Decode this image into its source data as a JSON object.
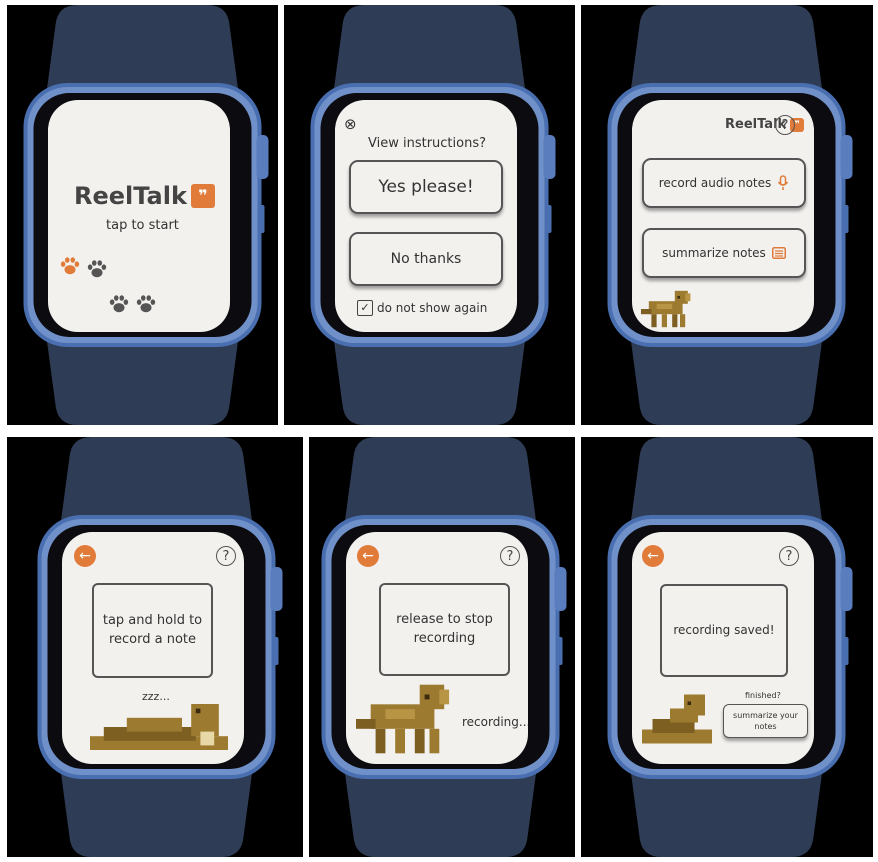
{
  "colors": {
    "accent": "#e07b39",
    "screen_bg": "#f3f1ee",
    "watch_frame": "#4a6fb0",
    "band": "#2e3d55",
    "text": "#333333",
    "cat": "#9c7a2f"
  },
  "icons": [
    "paw-icon",
    "close-circle-icon",
    "checkbox-icon",
    "microphone-icon",
    "notes-icon",
    "back-arrow-icon",
    "help-icon",
    "cat-sprite"
  ],
  "screens": [
    {
      "logo": "ReelTalk",
      "logo_badge": "❞",
      "subtitle": "tap to start"
    },
    {
      "close": "⊗",
      "prompt": "View instructions?",
      "yes": "Yes please!",
      "no": "No thanks",
      "checkbox_label": "do not show again",
      "checkbox_mark": "✓"
    },
    {
      "logo": "ReelTalk",
      "logo_badge": "❞",
      "help": "?",
      "record": "record audio notes",
      "summarize": "summarize notes"
    },
    {
      "back": "←",
      "help": "?",
      "box": "tap and hold to record a note",
      "status": "zzz..."
    },
    {
      "back": "←",
      "help": "?",
      "box": "release to stop recording",
      "status": "recording..."
    },
    {
      "back": "←",
      "help": "?",
      "box": "recording saved!",
      "finished": "finished?",
      "summarize": "summarize your notes"
    }
  ]
}
